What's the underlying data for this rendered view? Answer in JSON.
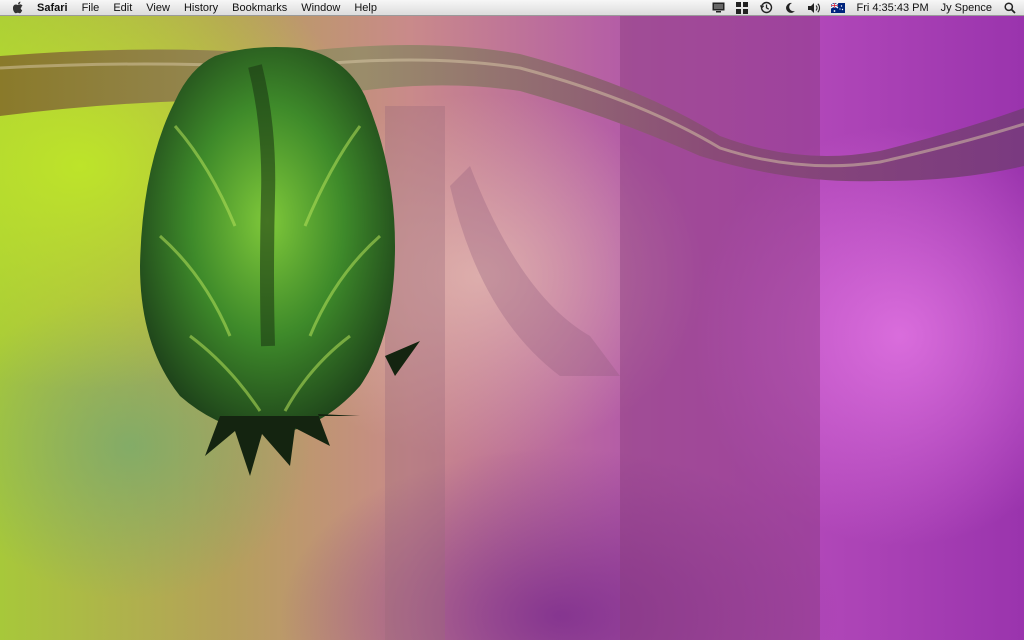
{
  "menubar": {
    "app_name": "Safari",
    "items": [
      "File",
      "Edit",
      "View",
      "History",
      "Bookmarks",
      "Window",
      "Help"
    ],
    "status_icons": [
      "display-icon",
      "spaces-icon",
      "time-machine-icon",
      "moon-icon",
      "volume-icon",
      "flag-icon"
    ],
    "clock": "Fri 4:35:43 PM",
    "user": "Jy Spence"
  },
  "colors": {
    "menubar_top": "#f7f7f7",
    "menubar_bottom": "#dcdcdc",
    "wallpaper_green": "#a7c83a",
    "wallpaper_purple": "#b047b8"
  }
}
